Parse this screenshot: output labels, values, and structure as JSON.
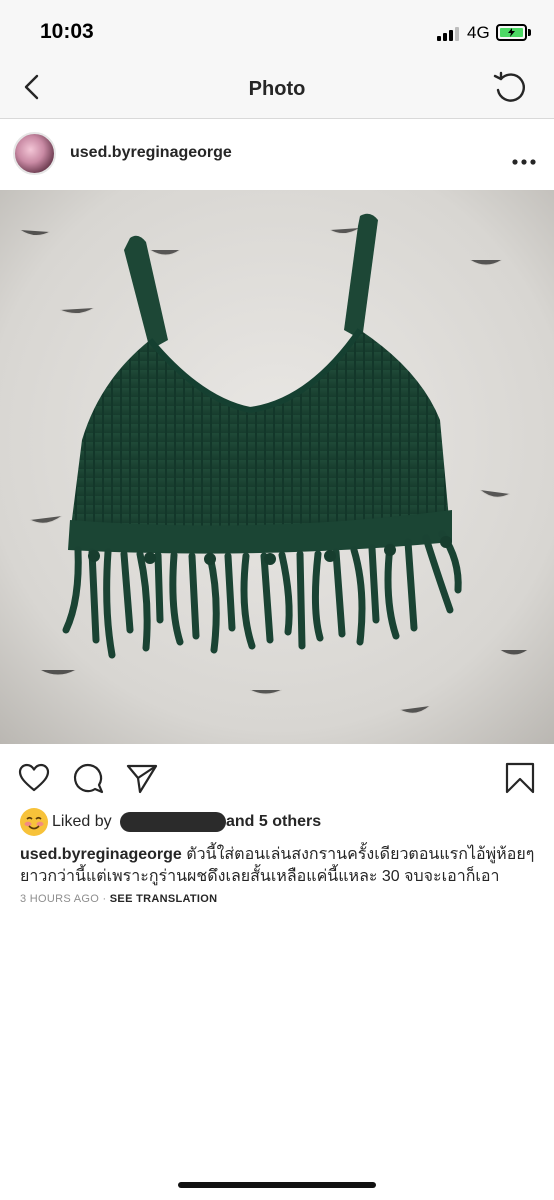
{
  "status_bar": {
    "time": "10:03",
    "network": "4G",
    "battery_color": "#4cd964"
  },
  "nav": {
    "title": "Photo",
    "back_icon": "chevron-left-icon",
    "refresh_icon": "refresh-icon"
  },
  "post": {
    "username": "used.byreginageorge",
    "more_icon": "more-horizontal-icon",
    "photo_subject": "green knitted fringe crop top on white fur rug",
    "actions": [
      "heart-icon",
      "comment-icon",
      "share-icon",
      "bookmark-icon"
    ],
    "likes": {
      "liked_by_label": "Liked by",
      "and_others": "and 5 others"
    },
    "caption": {
      "username": "used.byreginageorge",
      "text": "ตัวนี้ใส่ตอนเล่นสงกรานครั้งเดียวตอนแรกไอ้พู่ห้อยๆยาวกว่านี้แต่เพราะกูร่านผชดึงเลยสั้นเหลือแค่นี้แหละ 30 จบจะเอาก็เอา"
    },
    "timestamp": "3 HOURS AGO",
    "separator": "·",
    "see_translation": "SEE TRANSLATION"
  }
}
